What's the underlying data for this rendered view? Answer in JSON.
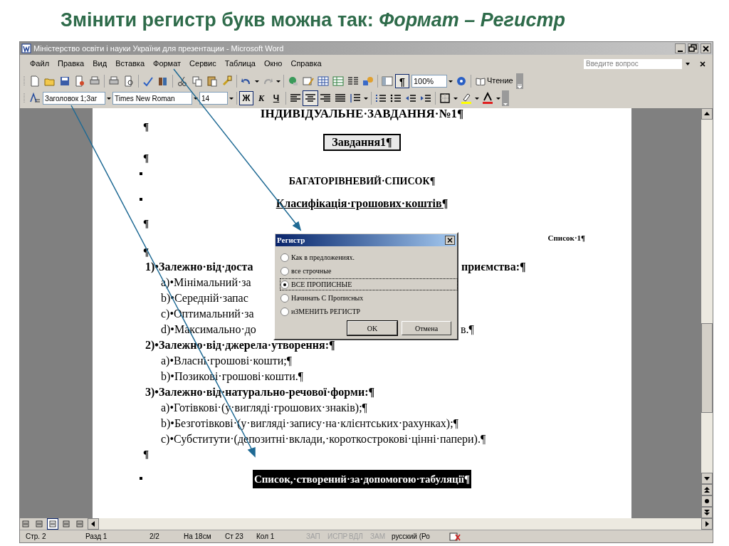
{
  "slide_title": "Змінити регистр букв можна так: *Формат – Регистр*",
  "window": {
    "title": "Міністерство освіти і науки України для презентации - Microsoft Word"
  },
  "menu": [
    "Файл",
    "Правка",
    "Вид",
    "Вставка",
    "Формат",
    "Сервис",
    "Таблица",
    "Окно",
    "Справка"
  ],
  "help_search": {
    "placeholder": "Введите вопрос"
  },
  "standard_toolbar": {
    "show_marks": {
      "label": "¶",
      "pressed": true
    },
    "zoom": "100%",
    "reading": "Чтение"
  },
  "formatting_toolbar": {
    "style": "Заголовок 1;Заг",
    "font": "Times New Roman",
    "size": "14",
    "font_styles": [
      {
        "label": "Ж",
        "pressed": true
      },
      {
        "label": "К",
        "pressed": false
      },
      {
        "label": "Ч",
        "pressed": false
      }
    ],
    "alignment": [
      {
        "pressed": false
      },
      {
        "pressed": true
      },
      {
        "pressed": false
      },
      {
        "pressed": false
      }
    ]
  },
  "document": {
    "lines": [
      {
        "kind": "heading",
        "text": "ІНДИВІДУАЛЬНЕ·ЗАВДАННЯ·№1¶"
      },
      {
        "kind": "mark",
        "text": "¶"
      },
      {
        "kind": "boxed",
        "text": "Завдання1¶"
      },
      {
        "kind": "mark",
        "text": "¶"
      },
      {
        "kind": "bullet-title",
        "text": "БАГАТОРІВНЕВИЙ·СПИСОК¶"
      },
      {
        "kind": "bullet-underlined",
        "text": "Класифікація·грошових·коштів¶"
      },
      {
        "kind": "mark",
        "text": "¶"
      },
      {
        "kind": "note",
        "text": "Список·1¶"
      },
      {
        "kind": "mark",
        "text": "¶"
      },
      {
        "kind": "group",
        "text": "1)•Залежно·від·доста",
        "text_right": "приємства:¶"
      },
      {
        "kind": "item",
        "text": "a)•Мінімальний·за"
      },
      {
        "kind": "item",
        "text": "b)•Середній·запас"
      },
      {
        "kind": "item",
        "text": "c)•Оптимальний·за"
      },
      {
        "kind": "item",
        "text": "d)•Максимально·до",
        "text_right": "в.¶"
      },
      {
        "kind": "group",
        "text": "2)•Залежно·від·джерела·утворення:¶"
      },
      {
        "kind": "item",
        "text": "a)•Власні·грошові·кошти;¶"
      },
      {
        "kind": "item",
        "text": "b)•Позикові·грошові·кошти.¶"
      },
      {
        "kind": "group",
        "text": "3)•Залежно·від·натурально-речової·форми:¶"
      },
      {
        "kind": "item",
        "text": "a)•Готівкові·(у·вигляді·грошових·знаків);¶"
      },
      {
        "kind": "item",
        "text": "b)•Безготівкові·(у·вигляді·запису·на·клієнтських·рахунках);¶"
      },
      {
        "kind": "item",
        "text": "c)•Субститути·(депозитні·вклади,·короткострокові·цінні·папери).¶"
      },
      {
        "kind": "mark",
        "text": "¶"
      },
      {
        "kind": "bullet-inverted",
        "text": "Список,·створений·за·допомогою·табуляції¶"
      }
    ]
  },
  "dialog": {
    "title": "Регистр",
    "options": [
      {
        "label": "Как в предложениях.",
        "selected": false
      },
      {
        "label": "все строчные",
        "selected": false
      },
      {
        "label": "ВСЕ ПРОПИСНЫЕ",
        "selected": true
      },
      {
        "label": "Начинать С Прописных",
        "selected": false
      },
      {
        "label": "иЗМЕНИТЬ РЕГИСТР",
        "selected": false
      }
    ],
    "buttons": [
      "OK",
      "Отмена"
    ]
  },
  "status_bar": {
    "items": [
      "Стр. 2",
      "Разд 1",
      "2/2",
      "На 18см",
      "Ст 23",
      "Кол 1"
    ],
    "modes": [
      {
        "label": "ЗАП",
        "disabled": true
      },
      {
        "label": "ИСПР",
        "disabled": true
      },
      {
        "label": "ВДЛ",
        "disabled": true
      },
      {
        "label": "ЗАМ",
        "disabled": true
      }
    ],
    "language": "русский (Ро"
  }
}
